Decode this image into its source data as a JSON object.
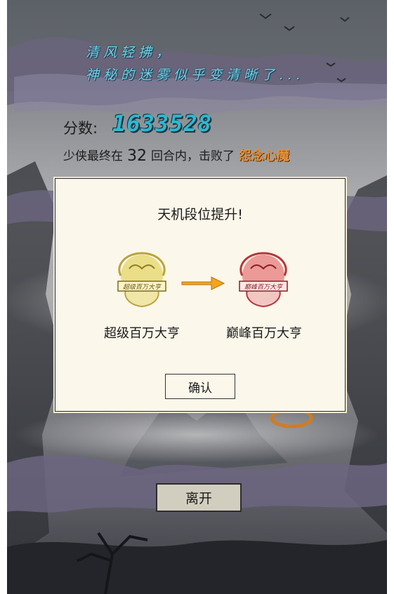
{
  "header": {
    "tagline_line1": "清风轻拂，",
    "tagline_line2": "神秘的迷雾似乎变清晰了..."
  },
  "score": {
    "label": "分数:",
    "value": "1633528"
  },
  "result": {
    "prefix": "少侠最终在",
    "rounds": "32",
    "middle": "回合内，击败了",
    "boss_name": "怨念心魔"
  },
  "dialog": {
    "title": "天机段位提升!",
    "rank_from": {
      "label": "超级百万大亨",
      "badge_text": "超级百万大亨",
      "badge_color": "#d9c24a"
    },
    "rank_to": {
      "label": "巅峰百万大亨",
      "badge_text": "巅峰百万大亨",
      "badge_color": "#d9565a"
    },
    "arrow_color": "#f2a51c",
    "confirm_label": "确认"
  },
  "footer": {
    "leave_label": "离开"
  }
}
